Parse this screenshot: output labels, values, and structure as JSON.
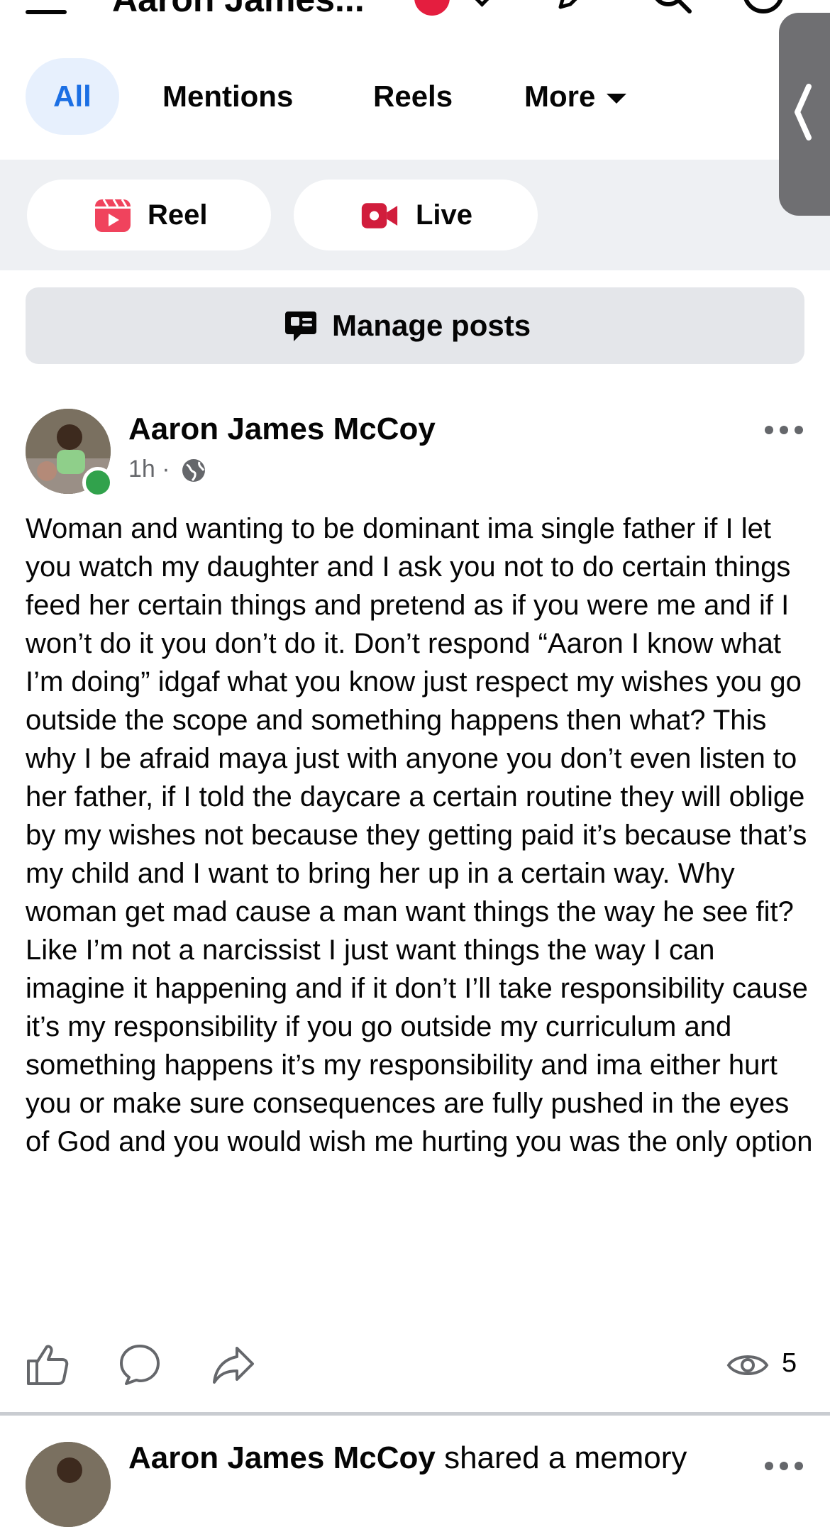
{
  "header": {
    "title": "Aaron James..."
  },
  "filter_tabs": [
    {
      "label": "All",
      "selected": true
    },
    {
      "label": "Mentions",
      "selected": false
    },
    {
      "label": "Reels",
      "selected": false
    },
    {
      "label": "More",
      "selected": false
    }
  ],
  "create": {
    "reel_label": "Reel",
    "live_label": "Live"
  },
  "manage_posts_label": "Manage posts",
  "post": {
    "author": "Aaron James McCoy",
    "time": "1h",
    "separator": "·",
    "audience_icon": "globe-icon",
    "body": "Woman and wanting to be dominant ima single father if I let you watch my daughter and I ask you not to do certain things feed her certain things and pretend as if you were me and if I won’t do it you don’t do it. Don’t respond “Aaron I know what I’m doing” idgaf what you know just respect my wishes you go outside the scope and something happens then what? This why I be afraid maya just with anyone you don’t even listen to her father, if I told the daycare a certain routine they will oblige by my wishes not because they getting paid it’s because that’s my child and I want to bring her up in a certain way. Why woman get mad cause a man want things the way he see fit? Like  I’m not a narcissist I just want things the way I can imagine it happening and if it don’t I’ll take responsibility cause it’s my responsibility if you go outside my curriculum and something happens it’s my responsibility and ima either hurt you or make sure consequences are fully pushed in the eyes of God and you would wish me hurting you was the only option",
    "view_count": "5"
  },
  "next_post": {
    "author": "Aaron James McCoy",
    "action": "shared a memory"
  },
  "colors": {
    "accent": "#1b6fe4",
    "tab_selected_bg": "#e7f0fd",
    "reel_icon": "#f0435d",
    "live_icon": "#d11d3c",
    "online": "#31a24c",
    "muted_text": "#65676b"
  }
}
